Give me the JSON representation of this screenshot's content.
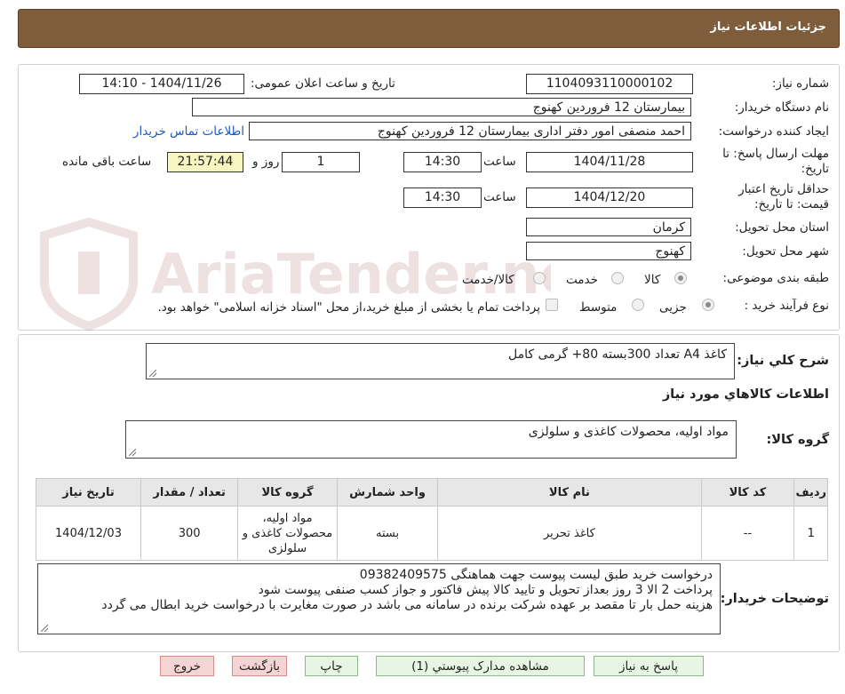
{
  "header": {
    "title": "جزئیات اطلاعات نیاز"
  },
  "watermark": {
    "text": "AriaTender.neT"
  },
  "info": {
    "need_number_label": "شماره نیاز:",
    "need_number": "1104093110000102",
    "announce_label": "تاریخ و ساعت اعلان عمومی:",
    "announce_value": "1404/11/26 - 14:10",
    "buyer_label": "نام دستگاه خریدار:",
    "buyer_value": "بیمارستان 12 فروردین کهنوج",
    "creator_label": "ایجاد کننده درخواست:",
    "creator_value": "احمد منصفی امور دفتر اداری بیمارستان 12 فروردین کهنوج",
    "contact_link": "اطلاعات تماس خریدار",
    "deadline_label": "مهلت ارسال پاسخ: تا تاریخ:",
    "deadline_date": "1404/11/28",
    "time_label": "ساعت",
    "deadline_time": "14:30",
    "days_value": "1",
    "days_label": "روز و",
    "remaining_value": "21:57:44",
    "remaining_label": "ساعت باقی مانده",
    "validity_label": "حداقل تاریخ اعتبار قیمت: تا تاریخ:",
    "validity_date": "1404/12/20",
    "validity_time": "14:30",
    "province_label": "استان محل تحویل:",
    "province_value": "کرمان",
    "city_label": "شهر محل تحویل:",
    "city_value": "کهنوج",
    "category_label": "طبقه بندی موضوعی:",
    "category_options": [
      "کالا",
      "خدمت",
      "کالا/خدمت"
    ],
    "category_selected": "کالا",
    "process_label": "نوع فرآیند خرید :",
    "process_options": [
      "جزیی",
      "متوسط"
    ],
    "process_selected": "جزیی",
    "payment_note": "پرداخت تمام یا بخشی از مبلغ خرید،از محل \"اسناد خزانه اسلامی\" خواهد بود."
  },
  "summary": {
    "label": "شرح کلي نياز:",
    "value": "کاغذ A4 تعداد 300بسته 80+ گرمی کامل"
  },
  "goods_section": {
    "title": "اطلاعات کالاهاي مورد نياز"
  },
  "goods_group": {
    "label": "گروه کالا:",
    "value": "مواد اولیه، محصولات کاغذی و سلولزی"
  },
  "table": {
    "headers": [
      "ردیف",
      "کد کالا",
      "نام کالا",
      "واحد شمارش",
      "گروه کالا",
      "تعداد / مقدار",
      "تاریخ نیاز"
    ],
    "rows": [
      {
        "row": "1",
        "code": "--",
        "name": "کاغذ تحریر",
        "unit": "بسته",
        "group": "مواد اولیه، محصولات کاغذی و سلولزی",
        "qty": "300",
        "date": "1404/12/03"
      }
    ]
  },
  "notes": {
    "label": "توضیحات خریدار:",
    "lines": [
      "درخواست خرید طبق لیست پیوست جهت هماهنگی 09382409575",
      "پرداخت 2 الا 3 روز بعداز تحویل و تایید کالا پیش فاکتور و جواز کسب صنفی پیوست شود",
      "هزینه حمل بار تا مقصد بر عهده شرکت برنده در سامانه می باشد در صورت مغایرت با درخواست خرید ابطال می گردد"
    ]
  },
  "buttons": {
    "reply": "پاسخ به نیاز",
    "attachments": "مشاهده مدارک پیوستي (1)",
    "print": "چاپ",
    "back": "بازگشت",
    "exit": "خروج"
  },
  "colors": {
    "header_bg": "#7d5d3b",
    "button_green": "#e7f6e3",
    "button_red": "#f7d4d4",
    "remaining_bg": "#f7f5c0"
  }
}
